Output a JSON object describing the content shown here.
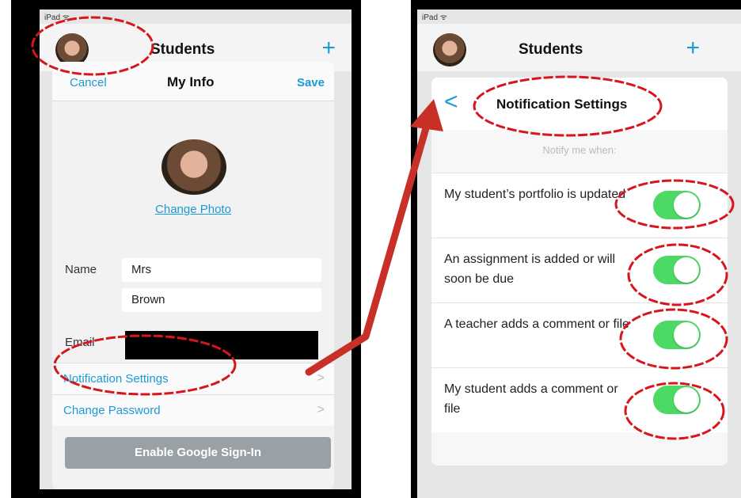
{
  "left": {
    "status": "iPad ᯤ",
    "nav_title": "Students",
    "plus": "+",
    "modal": {
      "cancel": "Cancel",
      "title": "My Info",
      "save": "Save",
      "change_photo": "Change Photo",
      "name_label": "Name",
      "first_name": "Mrs",
      "last_name": "Brown",
      "email_label": "Email",
      "notification_settings": "Notification Settings",
      "change_password": "Change Password",
      "chevron": ">",
      "google_button": "Enable Google Sign-In"
    }
  },
  "right": {
    "status": "iPad ᯤ",
    "nav_title": "Students",
    "plus": "+",
    "modal": {
      "back": "<",
      "title": "Notification Settings",
      "notify_when": "Notify me when:",
      "settings": [
        {
          "label": "My student’s portfolio is updated",
          "on": true
        },
        {
          "label": "An assignment is added or will soon be due",
          "on": true
        },
        {
          "label": "A teacher adds a comment or file",
          "on": true
        },
        {
          "label": "My student adds a comment or file",
          "on": true
        }
      ]
    }
  },
  "annotation": {
    "circle_color": "#d7161c",
    "arrow_color": "#c83027"
  },
  "colors": {
    "accent": "#1a9ad6",
    "toggle_on": "#4cd964"
  }
}
